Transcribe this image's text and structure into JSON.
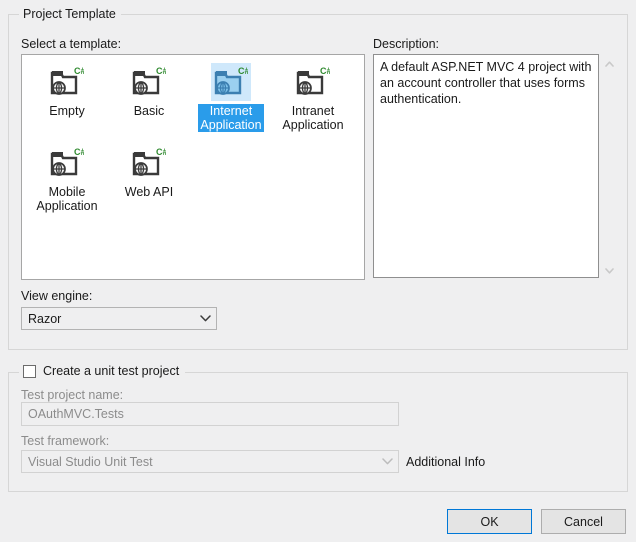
{
  "dialog": {
    "template_group_label": "Project Template",
    "select_template_label": "Select a template:",
    "description_label": "Description:",
    "description_text": "A default ASP.NET MVC 4 project with an account controller that uses forms authentication.",
    "view_engine_label": "View engine:",
    "view_engine_value": "Razor",
    "unit_test_checkbox_label": "Create a unit test project",
    "unit_test_checked": false,
    "test_project_name_label": "Test project name:",
    "test_project_name_value": "OAuthMVC.Tests",
    "test_framework_label": "Test framework:",
    "test_framework_value": "Visual Studio Unit Test",
    "additional_info_label": "Additional Info",
    "ok_label": "OK",
    "cancel_label": "Cancel"
  },
  "templates": [
    {
      "id": "empty",
      "label": "Empty",
      "icon": "csharp-web-project-icon",
      "selected": false
    },
    {
      "id": "basic",
      "label": "Basic",
      "icon": "csharp-web-project-icon",
      "selected": false
    },
    {
      "id": "internet-application",
      "label": "Internet\nApplication",
      "icon": "csharp-web-project-icon",
      "selected": true
    },
    {
      "id": "intranet-application",
      "label": "Intranet\nApplication",
      "icon": "csharp-web-project-icon",
      "selected": false
    },
    {
      "id": "mobile-application",
      "label": "Mobile\nApplication",
      "icon": "csharp-web-project-icon",
      "selected": false
    },
    {
      "id": "web-api",
      "label": "Web API",
      "icon": "csharp-web-project-icon",
      "selected": false
    }
  ],
  "icons": {
    "scroll_up": "▲",
    "scroll_down": "▼",
    "combo_chevron": "⌄",
    "csharp_badge": "C#"
  },
  "colors": {
    "selection_blue": "#2a9cea",
    "selection_icon_blue": "#cfe8fb",
    "focus_border_blue": "#0078d7",
    "dialog_background": "#efeff0",
    "csharp_green": "#2f8a2f",
    "disabled_text": "#8c8c8c"
  }
}
